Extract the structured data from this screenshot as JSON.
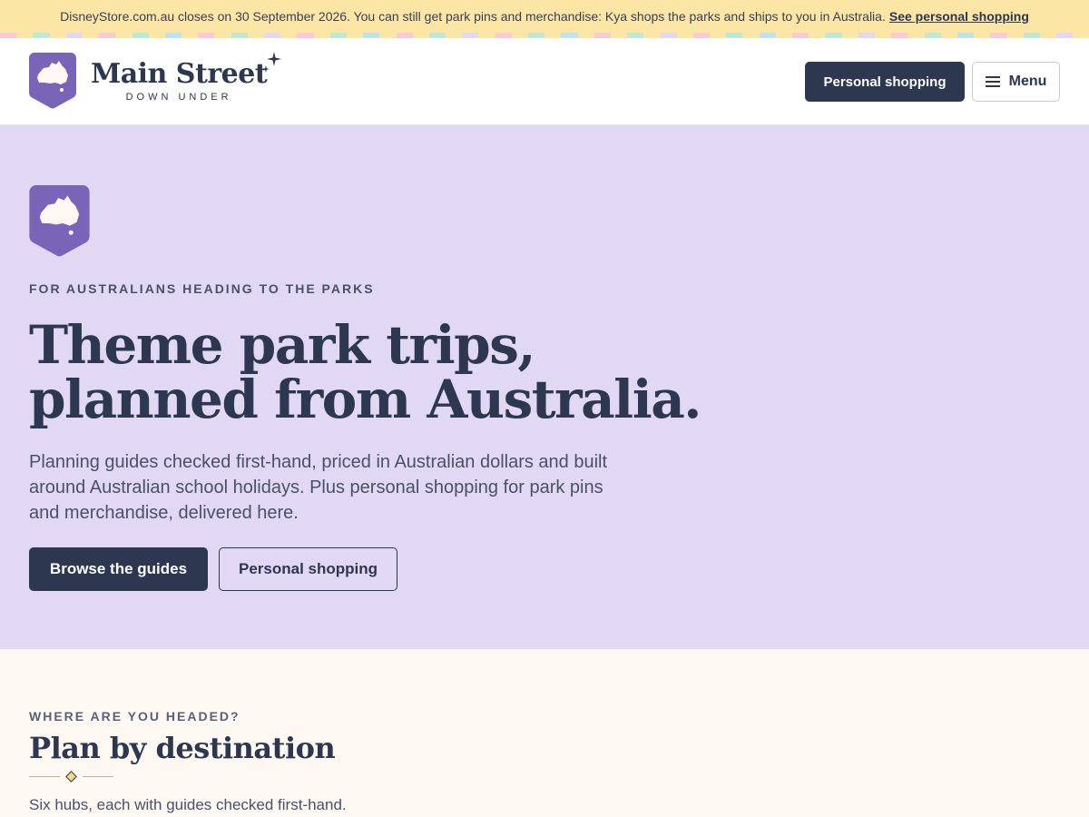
{
  "announcement": {
    "text": "DisneyStore.com.au closes on 30 September 2026. You can still get park pins and merchandise: Kya shops the parks and ships to you in Australia.",
    "link": "See personal shopping"
  },
  "stripe_colors": [
    "#f9c9d8",
    "#bfe3f3",
    "#bfe8d8",
    "#fbe6a6",
    "#e1d8f4"
  ],
  "brand": {
    "name": "Main Street",
    "tagline": "DOWN UNDER",
    "badge_color": "#7a64b8"
  },
  "header": {
    "personal_shopping_label": "Personal shopping",
    "menu_label": "Menu"
  },
  "hero": {
    "eyebrow": "FOR AUSTRALIANS HEADING TO THE PARKS",
    "title_line1": "Theme park trips,",
    "title_line2": "planned from Australia.",
    "description": "Planning guides checked first-hand, priced in Australian dollars and built around Australian school holidays. Plus personal shopping for park pins and merchandise, delivered here.",
    "primary_cta": "Browse the guides",
    "secondary_cta": "Personal shopping"
  },
  "destinations": {
    "eyebrow": "WHERE ARE YOU HEADED?",
    "title": "Plan by destination",
    "description": "Six hubs, each with guides checked first-hand."
  }
}
